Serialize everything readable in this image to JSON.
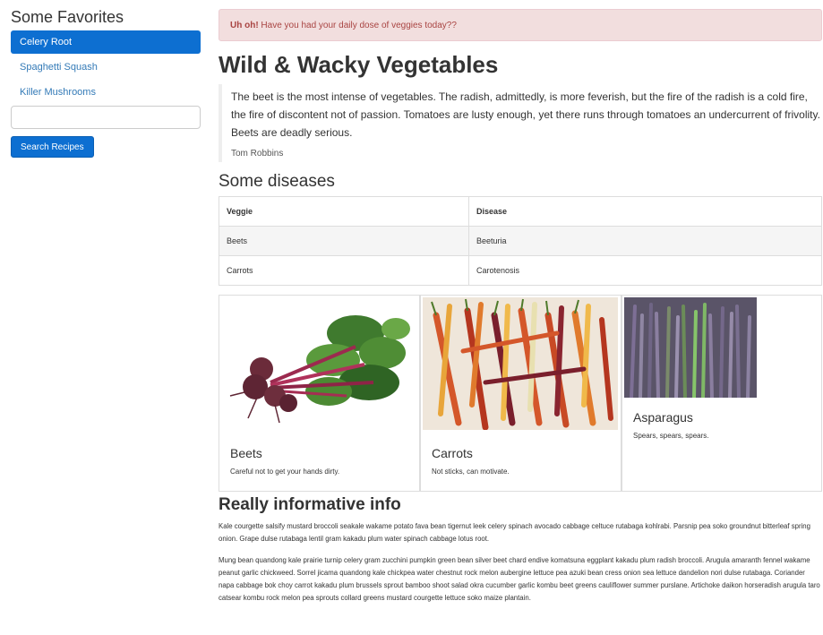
{
  "sidebar": {
    "heading": "Some Favorites",
    "items": [
      {
        "label": "Celery Root",
        "active": true
      },
      {
        "label": "Spaghetti Squash",
        "active": false
      },
      {
        "label": "Killer Mushrooms",
        "active": false
      }
    ],
    "search_value": "",
    "search_button": "Search Recipes"
  },
  "alert": {
    "strong": "Uh oh!",
    "text": " Have you had your daily dose of veggies today??"
  },
  "page_title": "Wild & Wacky Vegetables",
  "quote": {
    "text": "The beet is the most intense of vegetables. The radish, admittedly, is more feverish, but the fire of the radish is a cold fire, the fire of discontent not of passion. Tomatoes are lusty enough, yet there runs through tomatoes an undercurrent of frivolity. Beets are deadly serious.",
    "author": "Tom Robbins"
  },
  "diseases": {
    "heading": "Some diseases",
    "columns": [
      "Veggie",
      "Disease"
    ],
    "rows": [
      [
        "Beets",
        "Beeturia"
      ],
      [
        "Carrots",
        "Carotenosis"
      ]
    ]
  },
  "cards": [
    {
      "title": "Beets",
      "text": "Careful not to get your hands dirty."
    },
    {
      "title": "Carrots",
      "text": "Not sticks, can motivate."
    },
    {
      "title": "Asparagus",
      "text": "Spears, spears, spears."
    }
  ],
  "info": {
    "heading": "Really informative info",
    "paragraphs": [
      "Kale courgette salsify mustard broccoli seakale wakame potato fava bean tigernut leek celery spinach avocado cabbage celtuce rutabaga kohlrabi. Parsnip pea soko groundnut bitterleaf spring onion. Grape dulse rutabaga lentil gram kakadu plum water spinach cabbage lotus root.",
      "Mung bean quandong kale prairie turnip celery gram zucchini pumpkin green bean silver beet chard endive komatsuna eggplant kakadu plum radish broccoli. Arugula amaranth fennel wakame peanut garlic chickweed. Sorrel jicama quandong kale chickpea water chestnut rock melon aubergine lettuce pea azuki bean cress onion sea lettuce dandelion nori dulse rutabaga. Coriander napa cabbage bok choy carrot kakadu plum brussels sprout bamboo shoot salad okra cucumber garlic kombu beet greens cauliflower summer purslane. Artichoke daikon horseradish arugula taro catsear kombu rock melon pea sprouts collard greens mustard courgette lettuce soko maize plantain."
    ]
  },
  "colors": {
    "primary": "#0d6fd1",
    "alert_bg": "#f2dede",
    "alert_text": "#a94442"
  }
}
